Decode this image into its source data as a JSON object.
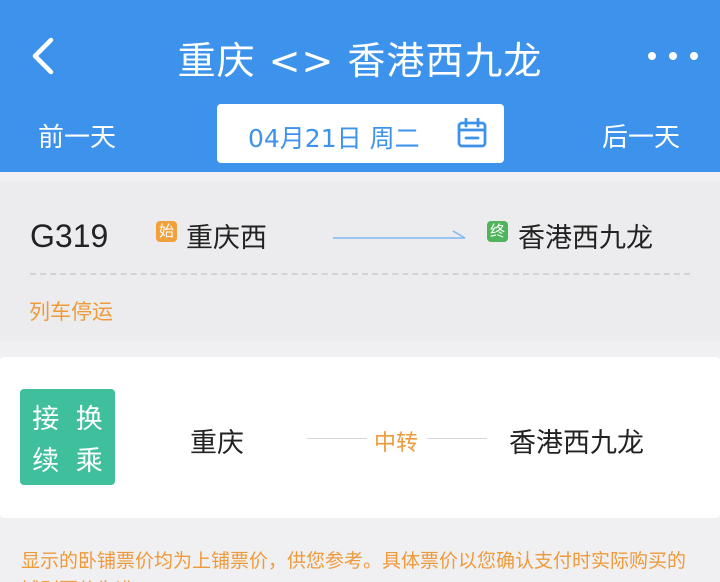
{
  "header": {
    "title": "重庆 <> 香港西九龙",
    "back_icon": "chevron-left-icon",
    "more_icon": "more-dots-icon",
    "prev_day": "前一天",
    "next_day": "后一天",
    "date": "04月21日 周二",
    "calendar_icon": "calendar-icon",
    "bg_color": "#3d93ec"
  },
  "train": {
    "number": "G319",
    "start_badge": "始",
    "from_station": "重庆西",
    "end_badge": "终",
    "to_station": "香港西九龙",
    "status": "列车停运"
  },
  "transfer": {
    "badge_chars": [
      "接",
      "换",
      "续",
      "乘"
    ],
    "from": "重庆",
    "middle": "中转",
    "to": "香港西九龙"
  },
  "note": "显示的卧铺票价均为上铺票价，供您参考。具体票价以您确认支付时实际购买的铺别票价为准。",
  "colors": {
    "accent": "#3d93ec",
    "warning": "#ef9a3a",
    "transfer_badge": "#3fbf9c",
    "start_badge": "#f2a13a",
    "end_badge": "#4fb45c"
  }
}
